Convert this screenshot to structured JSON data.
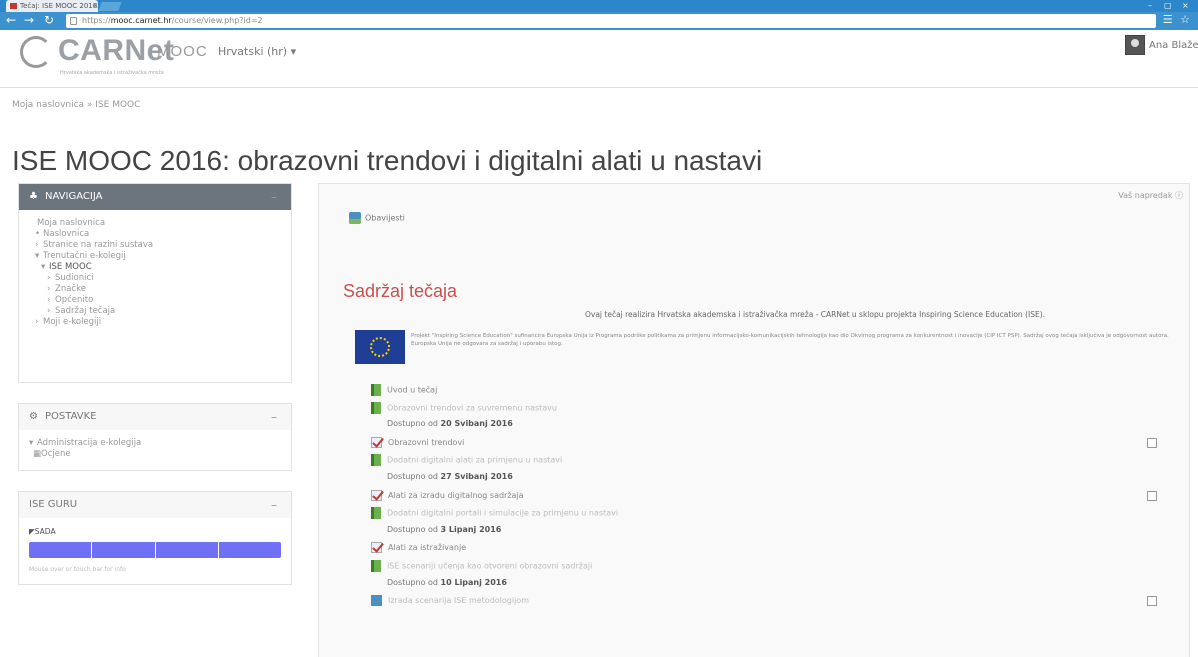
{
  "browser": {
    "tab_title": "Tečaj: ISE MOOC 2016",
    "tab_close": "×",
    "url_prefix": "https://",
    "url_host": "mooc.carnet.hr",
    "url_path": "/course/view.php?id=2",
    "window_controls": [
      "–",
      "▢",
      "×"
    ],
    "toolbar_icons": "☰ ☆"
  },
  "header": {
    "logo_text": "CARNet",
    "logo_tagline": "Hrvatska akademska i istraživačka mreža",
    "brand": "MOOC",
    "language": "Hrvatski (hr) ▾",
    "user_name": "Ana Blažević ▾"
  },
  "breadcrumb": "Moja naslovnica  »  ISE MOOC",
  "page_title": "ISE MOOC 2016: obrazovni trendovi i digitalni alati u nastavi",
  "nav_block": {
    "title": "NAVIGACIJA",
    "collapse": "–",
    "items": [
      {
        "mark": "",
        "label": "Moja naslovnica",
        "indent": 0
      },
      {
        "mark": "•",
        "label": "Naslovnica",
        "indent": 1
      },
      {
        "mark": "›",
        "label": "Stranice na razini sustava",
        "indent": 1
      },
      {
        "mark": "▾",
        "label": "Trenutačni e-kolegij",
        "indent": 1
      },
      {
        "mark": "▾",
        "label": "ISE MOOC",
        "indent": 2
      },
      {
        "mark": "›",
        "label": "Sudionici",
        "indent": 3
      },
      {
        "mark": "›",
        "label": "Značke",
        "indent": 3
      },
      {
        "mark": "›",
        "label": "Općenito",
        "indent": 3
      },
      {
        "mark": "›",
        "label": "Sadržaj tečaja",
        "indent": 3
      },
      {
        "mark": "›",
        "label": "Moji e-kolegiji",
        "indent": 1
      }
    ]
  },
  "settings_block": {
    "title": "POSTAVKE",
    "collapse": "–",
    "items": [
      {
        "mark": "▾",
        "label": "Administracija e-kolegija"
      },
      {
        "mark": "▦",
        "label": "Ocjene"
      }
    ]
  },
  "guru_block": {
    "title": "ISE GURU",
    "collapse": "–",
    "now_label": "SADA",
    "progress_segments": 4,
    "progress_fraction": 1,
    "progress_color": "#6f70f3",
    "note": "Mouse over or touch bar for info"
  },
  "main": {
    "edit_link": "Vaš napredak ⓘ",
    "announcements": "Obavijesti",
    "section_title": "Sadržaj tečaja",
    "intro": "Ovaj tečaj realizira Hrvatska akademska i istraživačka mreža - CARNet u sklopu projekta Inspiring Science Education (ISE).",
    "eu_text": "Projekt \"Inspiring Science Education\" sufinancira Europska Unija iz Programa podrške politikama za primjenu informacijsko-komunikacijskih tehnologija kao dio Okvirnog programa za konkurentnost i inovacije (CIP ICT PSP). Sadržaj ovog tečaja isključiva je odgovornost autora. Europska Unija ne odgovara za sadržaj i uporabu istog.",
    "activities": [
      {
        "icon": "book",
        "label": "Uvod u tečaj",
        "dim": false,
        "checkbox": false
      },
      {
        "icon": "book",
        "label": "Obrazovni trendovi za suvremenu nastavu",
        "dim": true,
        "checkbox": false
      },
      {
        "restrict_prefix": "Dostupno od",
        "restrict_date": "20 Svibanj 2016"
      },
      {
        "icon": "quiz",
        "label": "Obrazovni trendovi",
        "dim": false,
        "checkbox": true
      },
      {
        "icon": "book",
        "label": "Dodatni digitalni alati za primjenu u nastavi",
        "dim": true,
        "checkbox": false
      },
      {
        "restrict_prefix": "Dostupno od",
        "restrict_date": "27 Svibanj 2016"
      },
      {
        "icon": "quiz",
        "label": "Alati za izradu digitalnog sadržaja",
        "dim": false,
        "checkbox": true
      },
      {
        "icon": "book",
        "label": "Dodatni digitalni portali i simulacije za primjenu u nastavi",
        "dim": true,
        "checkbox": false
      },
      {
        "restrict_prefix": "Dostupno od",
        "restrict_date": "3 Lipanj 2016"
      },
      {
        "icon": "quiz",
        "label": "Alati za istraživanje",
        "dim": false,
        "checkbox": false
      },
      {
        "icon": "book",
        "label": "ISE scenariji učenja kao otvoreni obrazovni sadržaji",
        "dim": true,
        "checkbox": false
      },
      {
        "restrict_prefix": "Dostupno od",
        "restrict_date": "10 Lipanj 2016"
      },
      {
        "icon": "blue",
        "label": "Izrada scenarija ISE metodologijom",
        "dim": true,
        "checkbox": true
      }
    ]
  }
}
